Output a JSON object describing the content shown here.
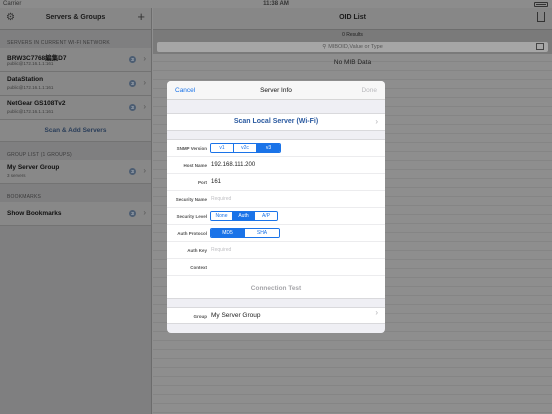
{
  "status_bar": {
    "carrier": "Carrier",
    "time": "11:38 AM"
  },
  "sidebar": {
    "title": "Servers & Groups",
    "servers_section": "SERVERS IN CURRENT WI-FI NETWORK",
    "servers": [
      {
        "name": "BRW3C7768編集D7",
        "address": "public@172.16.1.1:161",
        "count": "3"
      },
      {
        "name": "DataStation",
        "address": "public@172.16.1.1:161",
        "count": "3"
      },
      {
        "name": "NetGear GS108Tv2",
        "address": "public@172.16.1.1:161",
        "count": "3"
      }
    ],
    "scan_add_label": "Scan & Add Servers",
    "groups_section": "GROUP LIST (1 GROUPS)",
    "groups": [
      {
        "name": "My Server Group",
        "subtitle": "3 servers",
        "count": "3"
      }
    ],
    "bookmarks_section": "BOOKMARKS",
    "bookmarks": [
      {
        "name": "Show Bookmarks",
        "count": "3"
      }
    ]
  },
  "main": {
    "title": "OID List",
    "results": "0 Results",
    "search_placeholder": "MIBOID,Value or Type",
    "empty_message": "No MIB Data"
  },
  "modal": {
    "cancel": "Cancel",
    "title": "Server Info",
    "done": "Done",
    "scan_label": "Scan Local Server (Wi-Fi)",
    "snmp_version_label": "SNMP Version",
    "snmp_versions": [
      "v1",
      "v2c",
      "v3"
    ],
    "snmp_version_selected": "v3",
    "host_name_label": "Host Name",
    "host_name_value": "192.168.111.200",
    "port_label": "Port",
    "port_value": "161",
    "security_name_label": "Security Name",
    "security_name_placeholder": "Required",
    "security_level_label": "Security Level",
    "security_levels": [
      "None",
      "Auth",
      "A/P"
    ],
    "security_level_selected": "Auth",
    "auth_protocol_label": "Auth Protocol",
    "auth_protocols": [
      "MD5",
      "SHA"
    ],
    "auth_protocol_selected": "MD5",
    "auth_key_label": "Auth Key",
    "auth_key_placeholder": "Required",
    "context_label": "Context",
    "connection_test": "Connection Test",
    "group_label": "Group",
    "group_value": "My Server Group"
  },
  "colors": {
    "accent": "#1a73e8",
    "dim_overlay": "#8e8e8e"
  }
}
